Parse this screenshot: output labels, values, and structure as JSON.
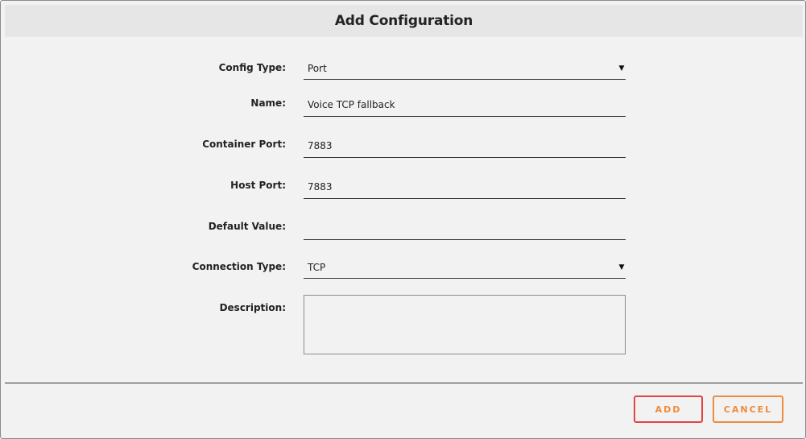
{
  "dialog": {
    "title": "Add Configuration"
  },
  "form": {
    "config_type": {
      "label": "Config Type:",
      "value": "Port"
    },
    "name": {
      "label": "Name:",
      "value": "Voice TCP fallback"
    },
    "container_port": {
      "label": "Container Port:",
      "value": "7883"
    },
    "host_port": {
      "label": "Host Port:",
      "value": "7883"
    },
    "default_value": {
      "label": "Default Value:",
      "value": ""
    },
    "connection_type": {
      "label": "Connection Type:",
      "value": "TCP"
    },
    "description": {
      "label": "Description:",
      "value": ""
    }
  },
  "footer": {
    "add_label": "ADD",
    "cancel_label": "CANCEL"
  },
  "icons": {
    "dropdown_caret": "▼"
  },
  "colors": {
    "add_border": "#e24545",
    "cancel_border": "#f08a3c",
    "button_text": "#f08a3c"
  }
}
